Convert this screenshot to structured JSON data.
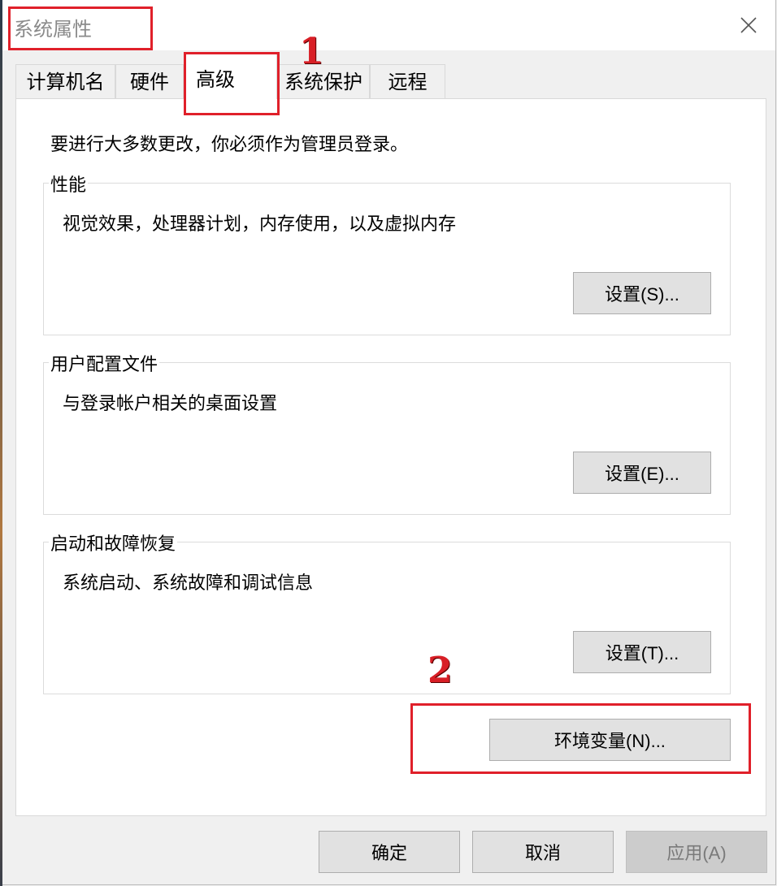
{
  "window": {
    "title": "系统属性"
  },
  "tabs": [
    {
      "label": "计算机名"
    },
    {
      "label": "硬件"
    },
    {
      "label": "高级",
      "active": true
    },
    {
      "label": "系统保护"
    },
    {
      "label": "远程"
    }
  ],
  "panel": {
    "notice": "要进行大多数更改，你必须作为管理员登录。",
    "groups": [
      {
        "title": "性能",
        "description": "视觉效果，处理器计划，内存使用，以及虚拟内存",
        "button": "设置(S)..."
      },
      {
        "title": "用户配置文件",
        "description": "与登录帐户相关的桌面设置",
        "button": "设置(E)..."
      },
      {
        "title": "启动和故障恢复",
        "description": "系统启动、系统故障和调试信息",
        "button": "设置(T)..."
      }
    ],
    "env_button": "环境变量(N)..."
  },
  "footer": {
    "ok": "确定",
    "cancel": "取消",
    "apply": "应用(A)"
  },
  "annotations": {
    "first": "1",
    "second": "2",
    "color": "#e0202a"
  },
  "icons": {
    "close": "close-icon"
  }
}
